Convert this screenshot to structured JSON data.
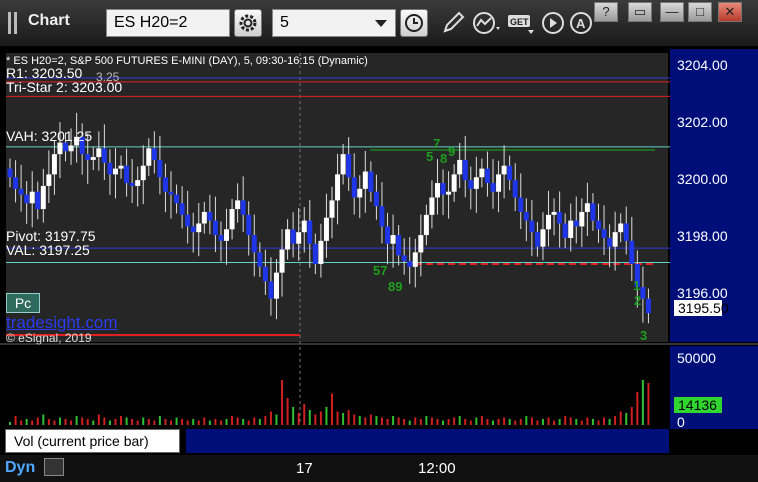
{
  "toolbar": {
    "title": "Chart",
    "symbol": "ES H20=2",
    "interval": "5"
  },
  "window_buttons": [
    "?",
    "▭",
    "—",
    "□",
    "✕"
  ],
  "chart": {
    "header": "* ES H20=2, S&P 500 FUTURES E-MINI (DAY), 5, 09:30-16:15 (Dynamic)",
    "lines": {
      "r1": "R1: 3203.50",
      "r1_overlap": "3.25",
      "tristar": "Tri-Star 2: 3203.00",
      "vah": "VAH: 3201.25",
      "pivot": "Pivot: 3197.75",
      "val": "VAL: 3197.25"
    },
    "price_ticks": [
      "3204.00",
      "3202.00",
      "3200.00",
      "3198.00",
      "3196.00"
    ],
    "last_price": "3195.50",
    "volume_ticks": [
      "50000",
      "0"
    ],
    "last_volume": "14136",
    "volume_legend": "Vol (current price bar)",
    "time_labels": [
      "17",
      "12:00"
    ],
    "brand": "tradesight.com",
    "copyright": "© eSignal, 2019",
    "pc_label": "Pc",
    "footer": "Dyn",
    "annotations": [
      "57",
      "89",
      "7",
      "5",
      "8",
      "9",
      "1",
      "2",
      "3"
    ],
    "colors": {
      "bar": "#1f36e8",
      "bar_up": "#ffffff",
      "pivot_line": "#2f3ad6",
      "vah_line": "#5fd3c9",
      "r1_line": "#e02020",
      "green_line": "#18b018",
      "price_axis_bg": "#000e7a"
    }
  },
  "chart_data": {
    "type": "candlestick",
    "title": "* ES H20=2, S&P 500 FUTURES E-MINI (DAY), 5, 09:30-16:15 (Dynamic)",
    "y_range": [
      3194.5,
      3204.5
    ],
    "levels": [
      {
        "name": "R1",
        "value": 3203.5
      },
      {
        "name": "Tri-Star 2",
        "value": 3203.0
      },
      {
        "name": "VAH",
        "value": 3201.25
      },
      {
        "name": "Pivot",
        "value": 3197.75
      },
      {
        "name": "VAL",
        "value": 3197.25
      }
    ],
    "last": 3195.5,
    "volume_last": 14136,
    "volume_range": [
      0,
      50000
    ],
    "closes": [
      3200.2,
      3199.8,
      3199.6,
      3199.3,
      3199.7,
      3199.1,
      3199.9,
      3200.3,
      3201.0,
      3201.4,
      3201.1,
      3201.3,
      3201.6,
      3201.0,
      3200.8,
      3200.9,
      3201.2,
      3200.7,
      3200.3,
      3200.5,
      3200.6,
      3200.0,
      3199.9,
      3200.1,
      3200.6,
      3201.2,
      3200.8,
      3200.2,
      3199.7,
      3199.6,
      3199.3,
      3198.9,
      3198.5,
      3198.3,
      3198.6,
      3199.0,
      3198.7,
      3198.2,
      3198.0,
      3198.4,
      3199.1,
      3199.4,
      3198.9,
      3198.2,
      3197.6,
      3197.1,
      3196.6,
      3196.0,
      3196.9,
      3197.7,
      3198.4,
      3197.9,
      3198.3,
      3198.7,
      3197.9,
      3197.2,
      3198.0,
      3198.8,
      3199.4,
      3200.3,
      3201.0,
      3200.2,
      3199.5,
      3199.8,
      3200.4,
      3199.7,
      3199.2,
      3198.5,
      3197.9,
      3198.2,
      3197.5,
      3197.3,
      3197.1,
      3197.6,
      3198.2,
      3198.9,
      3199.5,
      3200.0,
      3199.6,
      3199.7,
      3200.3,
      3200.8,
      3200.1,
      3199.8,
      3200.2,
      3200.5,
      3200.0,
      3199.7,
      3200.3,
      3200.6,
      3200.1,
      3199.5,
      3199.0,
      3198.7,
      3198.3,
      3197.8,
      3198.4,
      3198.9,
      3199.0,
      3198.6,
      3198.1,
      3198.7,
      3198.5,
      3199.0,
      3199.3,
      3198.7,
      3198.4,
      3198.1,
      3197.8,
      3198.3,
      3198.6,
      3198.0,
      3197.2,
      3196.4,
      3196.0,
      3195.5
    ],
    "volumes": [
      2,
      6,
      3,
      4,
      3,
      5,
      7,
      4,
      3,
      5,
      4,
      3,
      6,
      5,
      4,
      3,
      7,
      5,
      3,
      4,
      6,
      5,
      4,
      3,
      5,
      4,
      3,
      6,
      4,
      3,
      5,
      4,
      3,
      4,
      3,
      5,
      3,
      4,
      3,
      4,
      6,
      5,
      4,
      3,
      5,
      4,
      6,
      9,
      7,
      30,
      18,
      12,
      8,
      14,
      10,
      7,
      9,
      12,
      21,
      9,
      8,
      10,
      7,
      6,
      5,
      7,
      6,
      5,
      4,
      6,
      5,
      4,
      3,
      5,
      4,
      6,
      5,
      4,
      3,
      4,
      5,
      6,
      4,
      3,
      5,
      6,
      4,
      3,
      4,
      5,
      4,
      3,
      4,
      6,
      5,
      3,
      4,
      5,
      3,
      4,
      6,
      5,
      4,
      3,
      5,
      4,
      3,
      5,
      4,
      6,
      9,
      8,
      12,
      22,
      30,
      28
    ]
  }
}
